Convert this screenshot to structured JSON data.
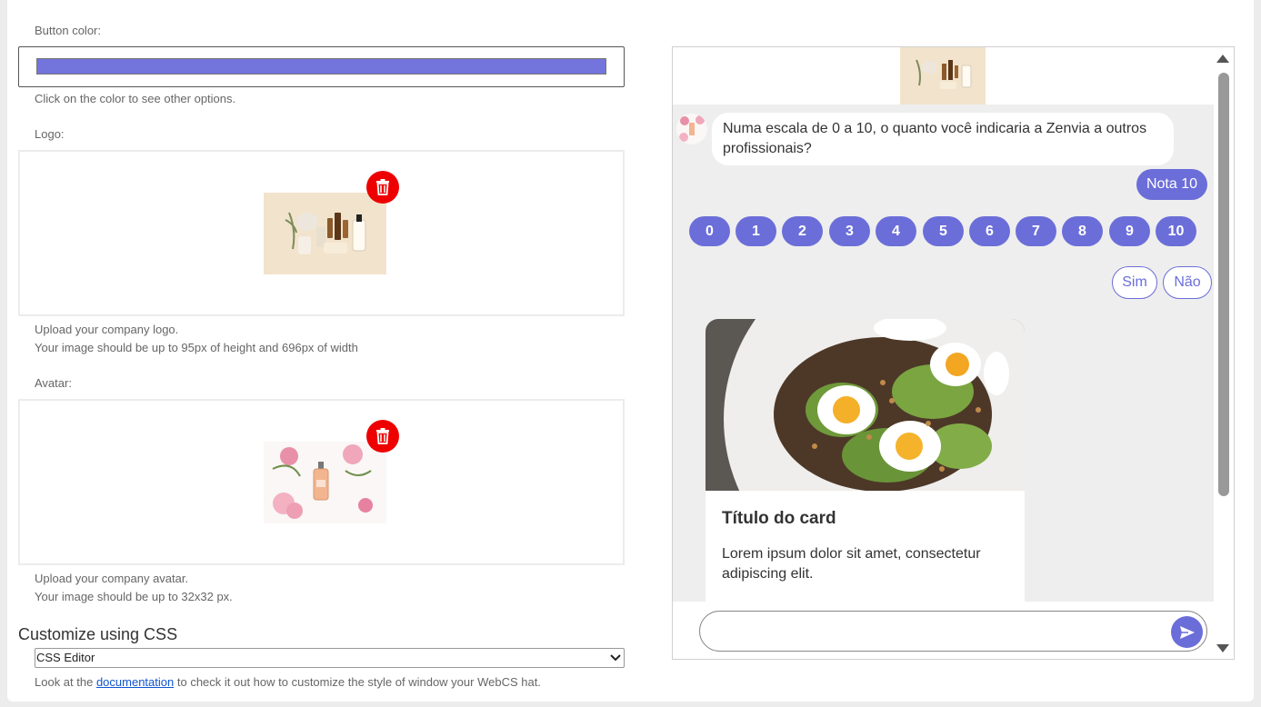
{
  "form": {
    "button_color_label": "Button color:",
    "button_color_value": "#7374dc",
    "button_color_hint": "Click on the color to see other options.",
    "logo_label": "Logo:",
    "logo_hint_1": "Upload your company logo.",
    "logo_hint_2": "Your image should be up to 95px of height and 696px of width",
    "avatar_label": "Avatar:",
    "avatar_hint_1": "Upload your company avatar.",
    "avatar_hint_2": "Your image should be up to 32x32 px.",
    "css_title": "Customize using CSS",
    "css_select_value": "CSS Editor",
    "doc_prefix": "Look at the",
    "doc_link": "documentation",
    "doc_suffix": "to check it out how to customize the style of window your WebCS hat."
  },
  "chat": {
    "question": "Numa escala de 0 a 10, o quanto você indicaria a Zenvia a outros profissionais?",
    "reply": "Nota 10",
    "nps_options": [
      "0",
      "1",
      "2",
      "3",
      "4",
      "5",
      "6",
      "7",
      "8",
      "9",
      "10"
    ],
    "yes": "Sim",
    "no": "Não",
    "card_title": "Título do card",
    "card_text": "Lorem ipsum dolor sit amet, consectetur adipiscing elit.",
    "composer_placeholder": ""
  },
  "colors": {
    "accent": "#6b6ed8",
    "delete": "#ee0000"
  },
  "icons": [
    "trash-icon",
    "send-icon",
    "chevron-down-icon"
  ]
}
